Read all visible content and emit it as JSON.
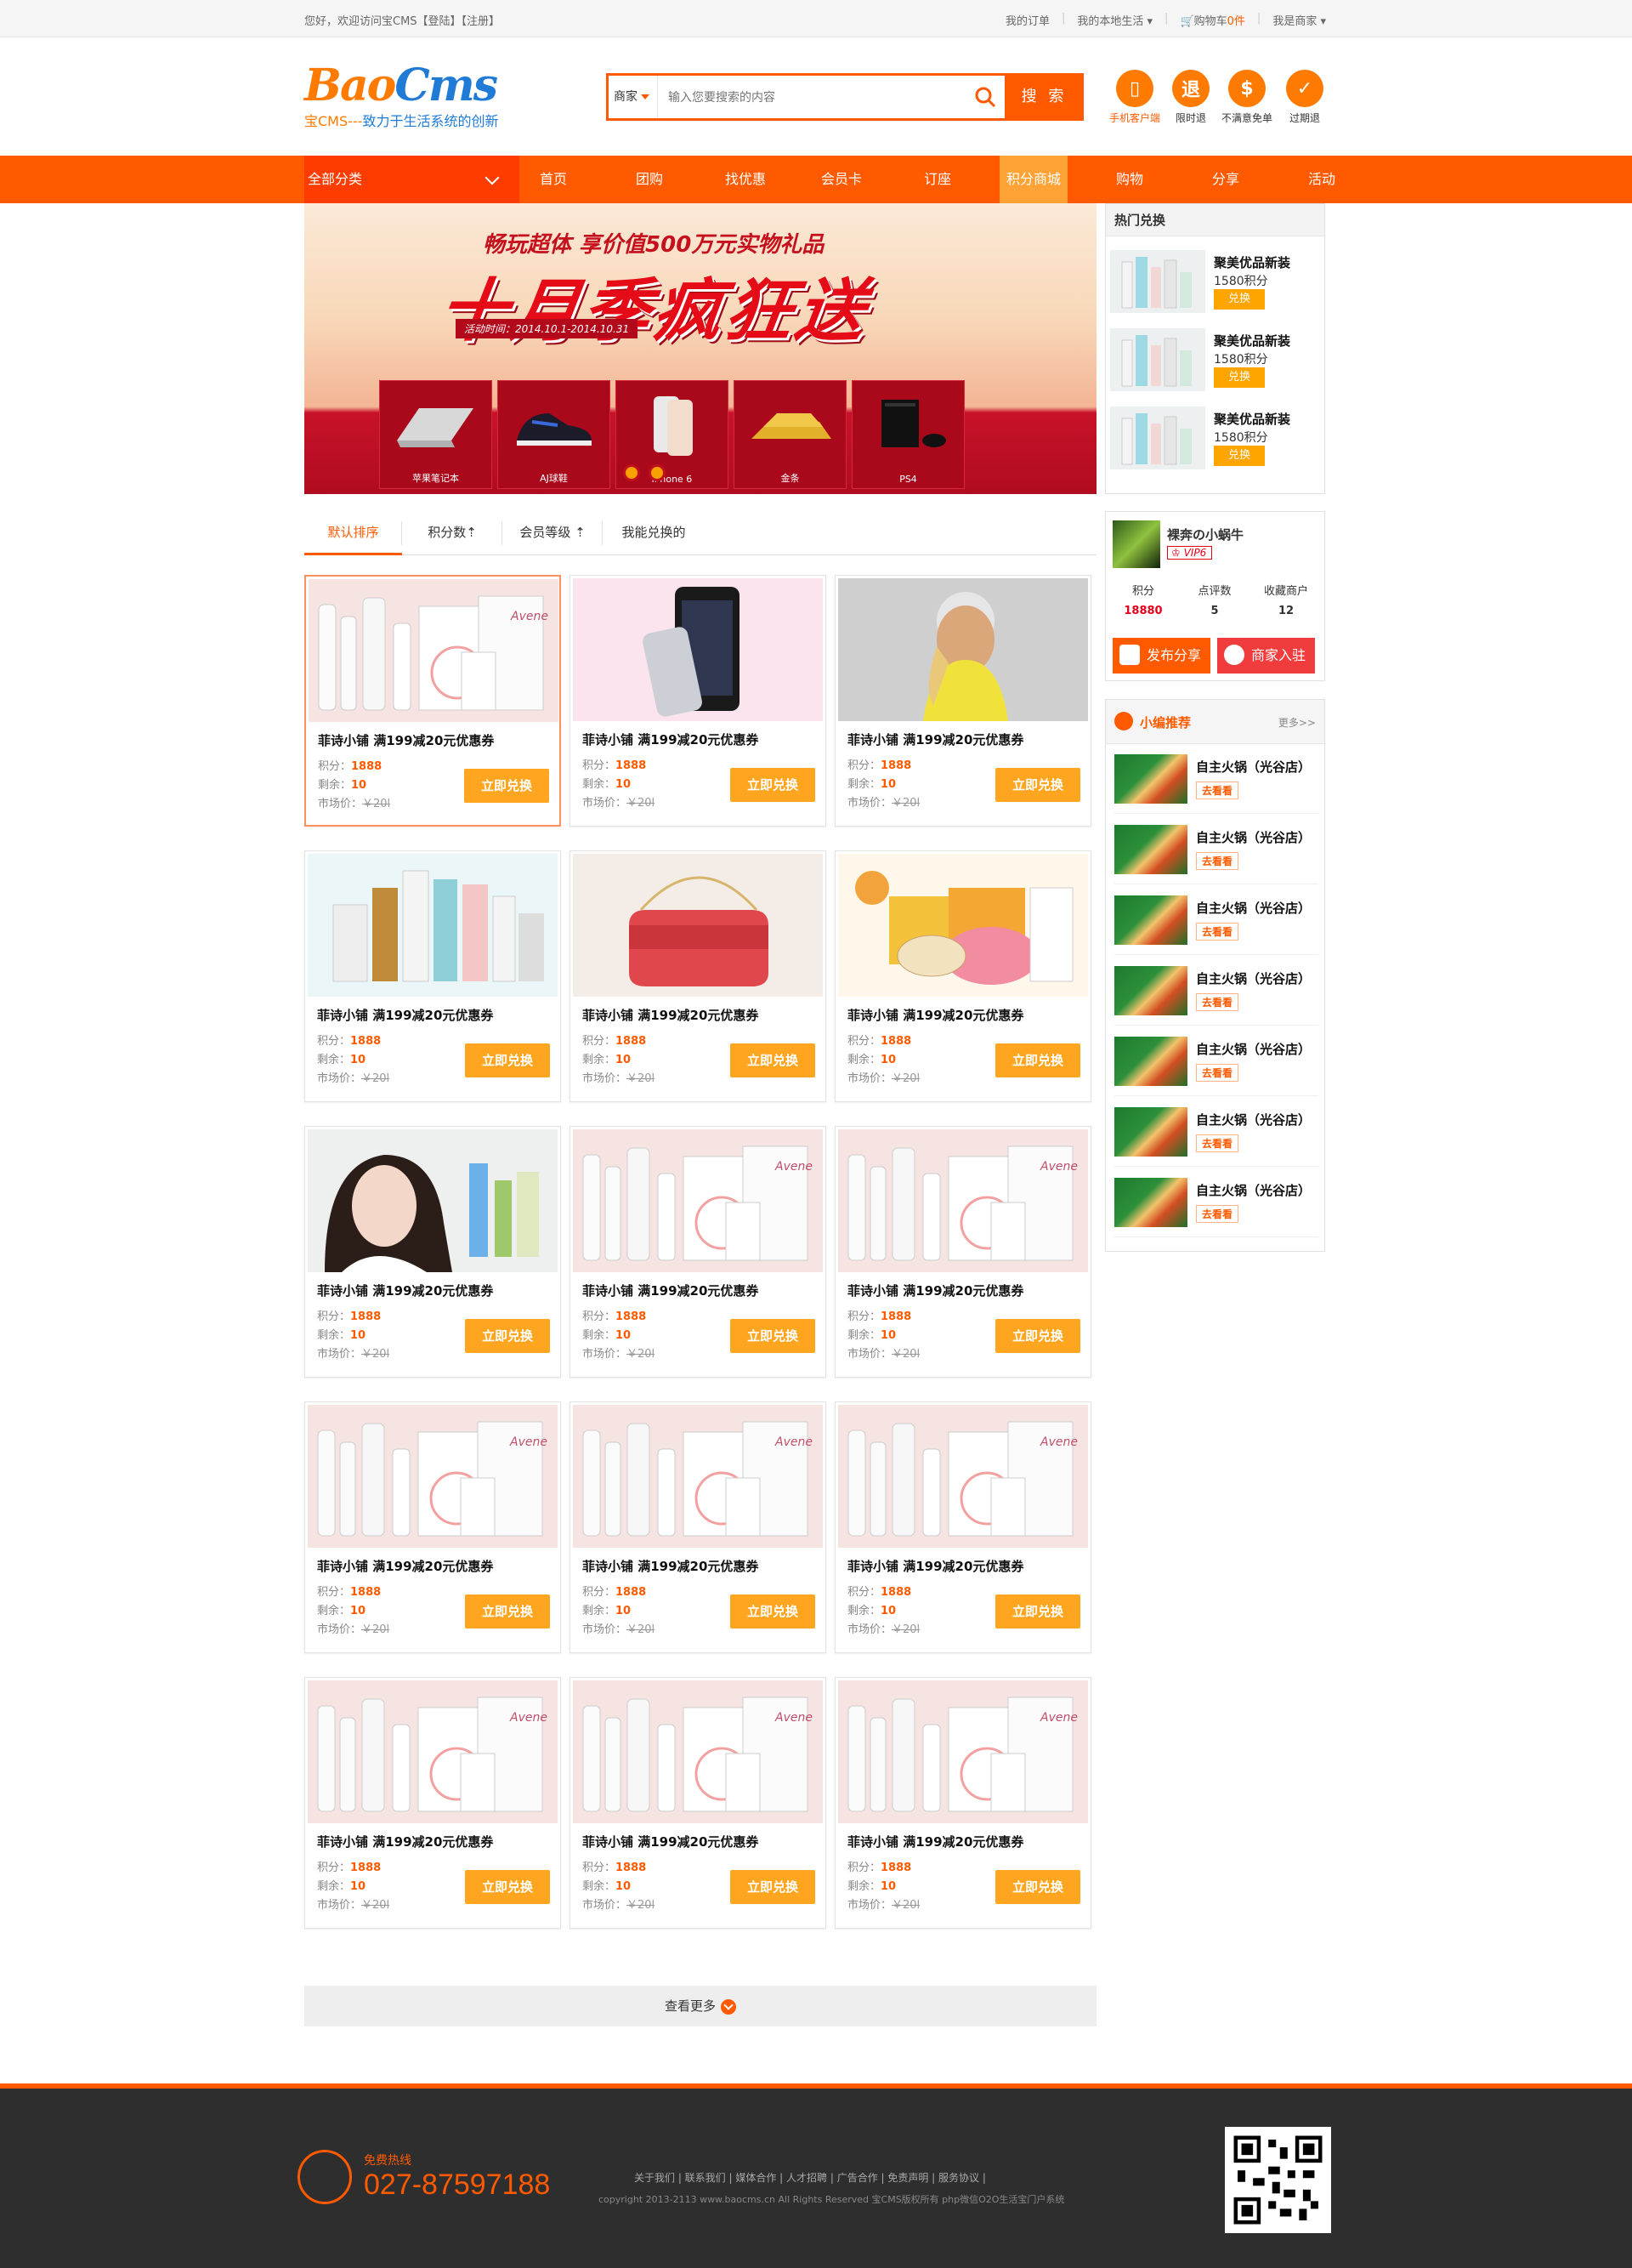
{
  "topbar": {
    "welcome": "您好，欢迎访问宝CMS【登陆】【注册】",
    "links": [
      "我的订单",
      "我的本地生活",
      "购物车",
      "我是商家"
    ],
    "cart_count": "0件"
  },
  "logo": {
    "brand_a": "Bao",
    "brand_b": "Cms",
    "slogan_a": "宝CMS---",
    "slogan_b": "致力于生活系统的创新"
  },
  "search": {
    "category": "商家",
    "placeholder": "输入您要搜索的内容",
    "button": "搜 索"
  },
  "header_icons": [
    {
      "label": "手机客户端",
      "icon": "phone-icon",
      "glyph": "▯"
    },
    {
      "label": "限时退",
      "icon": "refund-icon",
      "glyph": "退"
    },
    {
      "label": "不满意免单",
      "icon": "dollar-icon",
      "glyph": "$"
    },
    {
      "label": "过期退",
      "icon": "check-icon",
      "glyph": "✓"
    }
  ],
  "nav": {
    "all_categories": "全部分类",
    "items": [
      "首页",
      "团购",
      "找优惠",
      "会员卡",
      "订座",
      "积分商城",
      "购物",
      "分享",
      "活动"
    ],
    "active_index": 5
  },
  "banner": {
    "title_top": "畅玩超体 享价值500万元实物礼品",
    "title_main": "十月季疯狂送",
    "date": "活动时间：2014.10.1-2014.10.31",
    "products": [
      "苹果笔记本",
      "AJ球鞋",
      "iPhone 6",
      "金条",
      "PS4"
    ]
  },
  "hot_exchange": {
    "title": "热门兑换",
    "items": [
      {
        "name": "聚美优品新装",
        "points": "1580",
        "unit": "积分",
        "button": "兑换"
      },
      {
        "name": "聚美优品新装",
        "points": "1580",
        "unit": "积分",
        "button": "兑换"
      },
      {
        "name": "聚美优品新装",
        "points": "1580",
        "unit": "积分",
        "button": "兑换"
      }
    ]
  },
  "sort": {
    "items": [
      "默认排序",
      "积分数⇡",
      "会员等级 ⇡",
      "我能兑换的"
    ],
    "active_index": 0
  },
  "products": {
    "title": "菲诗小铺 满199减20元优惠券",
    "points_label": "积分：",
    "points": "1888",
    "remain_label": "剩余：",
    "remain": "10",
    "market_label": "市场价：",
    "market_price": "￥20l",
    "button": "立即兑换",
    "images": [
      "cosmetics",
      "phone",
      "model",
      "skincare",
      "bag",
      "masks",
      "girl",
      "cosmetics",
      "cosmetics",
      "cosmetics",
      "cosmetics",
      "cosmetics",
      "cosmetics",
      "cosmetics",
      "cosmetics"
    ]
  },
  "more": {
    "label": "查看更多"
  },
  "user": {
    "name": "裸奔の小蜗牛",
    "vip": "VIP6",
    "stats": [
      {
        "label": "积分",
        "value": "18880"
      },
      {
        "label": "点评数",
        "value": "5"
      },
      {
        "label": "收藏商户",
        "value": "12"
      }
    ],
    "share_button": "发布分享",
    "join_button": "商家入驻"
  },
  "recommend": {
    "title": "小编推荐",
    "more": "更多>>",
    "item_name": "自主火锅（光谷店）",
    "go_label": "去看看",
    "count": 7
  },
  "footer": {
    "hotline_label": "免费热线",
    "hotline": "027-87597188",
    "links": "关于我们 | 联系我们 | 媒体合作 | 人才招聘 | 广告合作 | 免责声明 | 服务协议 |",
    "copyright": "copyright 2013-2113 www.baocms.cn All Rights Reserved 宝CMS版权所有 php微信O2O生活宝门户系统"
  },
  "colors": {
    "accent": "#ff5a00",
    "accent_light": "#ffa337",
    "button": "#ffa51f",
    "red": "#e4001a"
  }
}
